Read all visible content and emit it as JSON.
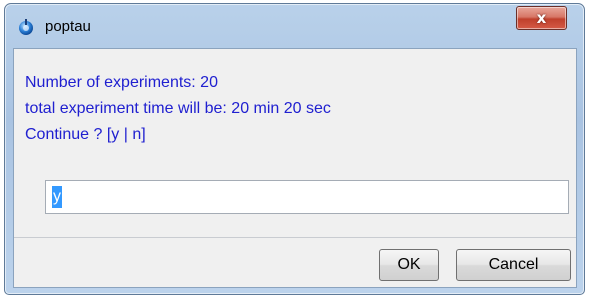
{
  "window": {
    "title": "poptau",
    "close_glyph": "x",
    "icon": "app-icon"
  },
  "message": {
    "line1": "Number of experiments: 20",
    "line2": "total experiment time will be: 20 min 20 sec",
    "line3": "Continue ? [y | n]"
  },
  "input": {
    "value": "y"
  },
  "buttons": {
    "ok_label": "OK",
    "cancel_label": "Cancel"
  },
  "colors": {
    "message_text": "#2020d0",
    "selection": "#3399ff",
    "close_button": "#c0402c"
  }
}
